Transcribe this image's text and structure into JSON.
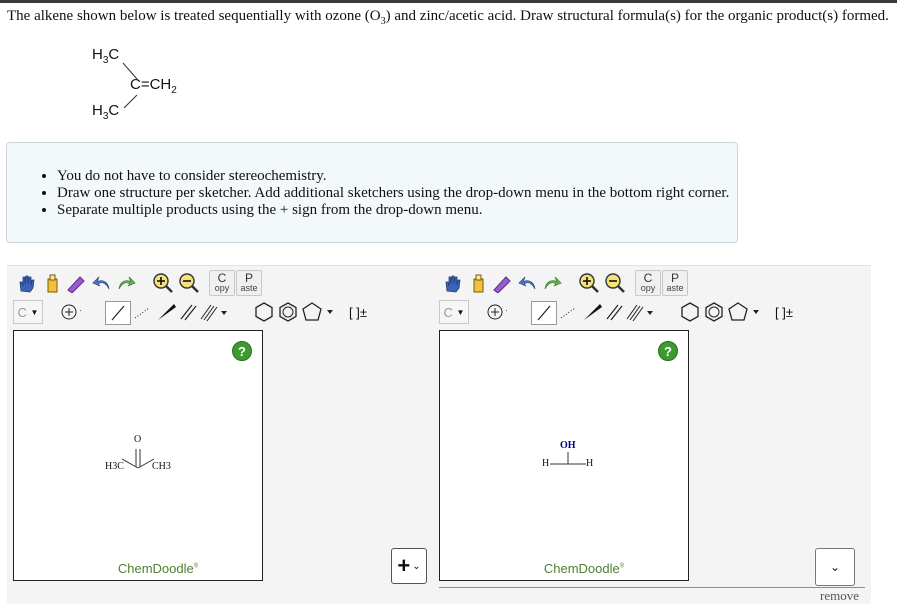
{
  "question": {
    "text_before": "The alkene shown below is treated sequentially with ozone (O",
    "sub": "3",
    "text_after": ") and zinc/acetic acid. Draw structural formula(s) for the organic product(s) formed."
  },
  "reactant": {
    "top_methyl": "H3C",
    "bottom_methyl": "H3C",
    "double_bond": "C=CH2"
  },
  "instructions": [
    "You do not have to consider stereochemistry.",
    "Draw one structure per sketcher. Add additional sketchers using the drop-down menu in the bottom right corner.",
    "Separate multiple products using the + sign from the drop-down menu."
  ],
  "toolbar": {
    "copy_label_top": "C",
    "copy_label_bottom": "opy",
    "paste_label_top": "P",
    "paste_label_bottom": "aste",
    "element_select": "C",
    "charge_label": "[ ]±",
    "icons": [
      "hand-icon",
      "eraser-icon",
      "clear-icon",
      "undo-icon",
      "redo-icon",
      "zoom-in-icon",
      "zoom-out-icon"
    ]
  },
  "sketchers": [
    {
      "brand": "ChemDoodle",
      "help": "?",
      "molecule": {
        "oxygen": "O",
        "left": "H3C",
        "right": "CH3"
      }
    },
    {
      "brand": "ChemDoodle",
      "help": "?",
      "molecule": {
        "oh": "OH",
        "left": "H",
        "right": "H"
      }
    }
  ],
  "plus_select": "+",
  "remove_label": "remove",
  "colors": {
    "brand_green": "#4f7f30",
    "help_green": "#3d9a2f",
    "info_bg": "#f3f8fa",
    "blue_text": "#00008b"
  }
}
